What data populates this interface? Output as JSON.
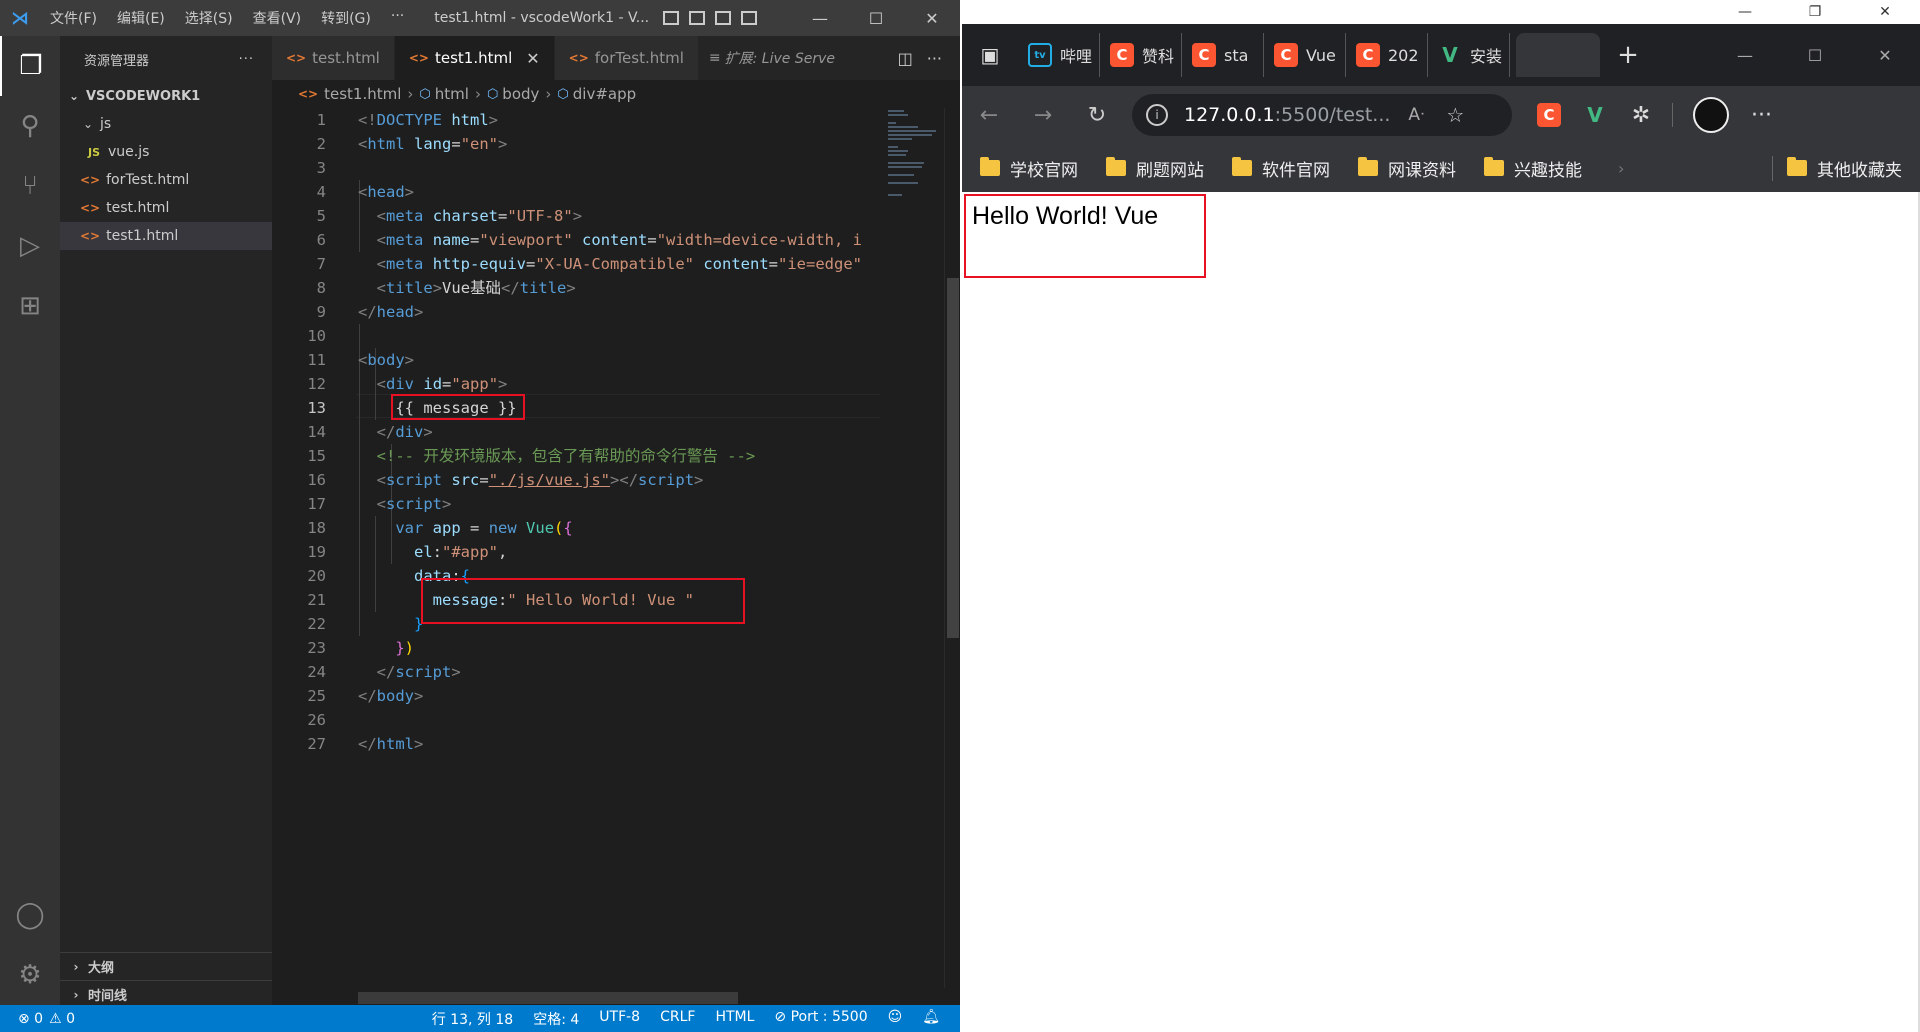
{
  "vscode": {
    "title_menu": [
      "文件(F)",
      "编辑(E)",
      "选择(S)",
      "查看(V)",
      "转到(G)",
      "···"
    ],
    "window_title": "test1.html - vscodeWork1 - V...",
    "explorer": {
      "header": "资源管理器",
      "more": "···",
      "workspace": "VSCODEWORK1",
      "folder_js": "js",
      "file_vuejs": "vue.js",
      "file_fortest": "forTest.html",
      "file_test": "test.html",
      "file_test1": "test1.html",
      "outline": "大纲",
      "timeline": "时间线"
    },
    "tabs": {
      "tab1": "test.html",
      "tab2": "test1.html",
      "tab3": "forTest.html",
      "tab4": "扩展: Live Serve"
    },
    "breadcrumb": [
      "test1.html",
      "html",
      "body",
      "div#app"
    ],
    "line_numbers": [
      "1",
      "2",
      "3",
      "4",
      "5",
      "6",
      "7",
      "8",
      "9",
      "10",
      "11",
      "12",
      "13",
      "14",
      "15",
      "16",
      "17",
      "18",
      "19",
      "20",
      "21",
      "22",
      "23",
      "24",
      "25",
      "26",
      "27"
    ],
    "code": {
      "l5_charset": "\"UTF-8\"",
      "l6_content": "\"width=device-width, i",
      "l7_equiv": "\"X-UA-Compatible\"",
      "l7_content": "\"ie=edge\"",
      "l8_title": "Vue基础",
      "l12_id": "\"app\"",
      "l13_text": "{{ message }}",
      "l15_comment": "<!-- 开发环境版本，包含了有帮助的命令行警告 -->",
      "l16_src": "\"./js/vue.js\"",
      "l19_el": "\"#app\"",
      "l21_message": "\" Hello World! Vue \""
    },
    "status": {
      "errors": "⊗ 0",
      "warnings": "⚠ 0",
      "position": "行 13, 列 18",
      "spaces": "空格: 4",
      "encoding": "UTF-8",
      "eol": "CRLF",
      "language": "HTML",
      "port": "⊘ Port : 5500"
    }
  },
  "browser": {
    "tabs": [
      {
        "icon": "bilibili",
        "label": "哔哩"
      },
      {
        "icon": "C",
        "label": "赞科"
      },
      {
        "icon": "C",
        "label": "sta"
      },
      {
        "icon": "C",
        "label": "Vue"
      },
      {
        "icon": "C",
        "label": "202"
      },
      {
        "icon": "vue",
        "label": "安装"
      }
    ],
    "address_host": "127.0.0.1",
    "address_path": ":5500/test...",
    "bookmarks": [
      "学校官网",
      "刷题网站",
      "软件官网",
      "网课资料",
      "兴趣技能"
    ],
    "other_bookmarks": "其他收藏夹",
    "page_text": "Hello World! Vue"
  }
}
